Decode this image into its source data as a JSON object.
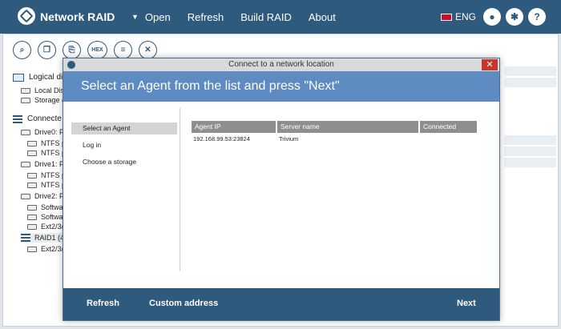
{
  "app": {
    "title": "Network RAID",
    "menu": [
      "Open",
      "Refresh",
      "Build RAID",
      "About"
    ],
    "language": "ENG"
  },
  "toolbar": {
    "hex_label": "HEX"
  },
  "tree": {
    "logical": "Logical di",
    "local": "Local Disk",
    "storage": "Storage (",
    "connected": "Connecte",
    "drive0": "Drive0: F",
    "ntfs_a": "NTFS pa",
    "ntfs_b": "NTFS pa",
    "drive1": "Drive1: F",
    "ntfs_c": "NTFS pa",
    "ntfs_d": "NTFS pa",
    "drive2": "Drive2: F",
    "sw_a": "Software",
    "sw_b": "Software",
    "ext_a": "Ext2/3/4",
    "raid1": "RAID1 (4",
    "ext_b": "Ext2/3/4"
  },
  "dialog": {
    "window_title": "Connect to a network location",
    "heading": "Select an Agent from the list and press \"Next\"",
    "steps": [
      "Select an Agent",
      "Log in",
      "Choose a storage"
    ],
    "columns": [
      "Agent IP",
      "Server name",
      "Connected"
    ],
    "rows": [
      {
        "ip": "192.168.99.53:23824",
        "server": "Trivium",
        "connected": ""
      }
    ],
    "footer": {
      "refresh": "Refresh",
      "custom": "Custom address",
      "next": "Next"
    }
  },
  "colors": {
    "header_bg": "#2e5a7d",
    "banner_bg": "#5e8bc1",
    "close_red": "#c7362b"
  }
}
